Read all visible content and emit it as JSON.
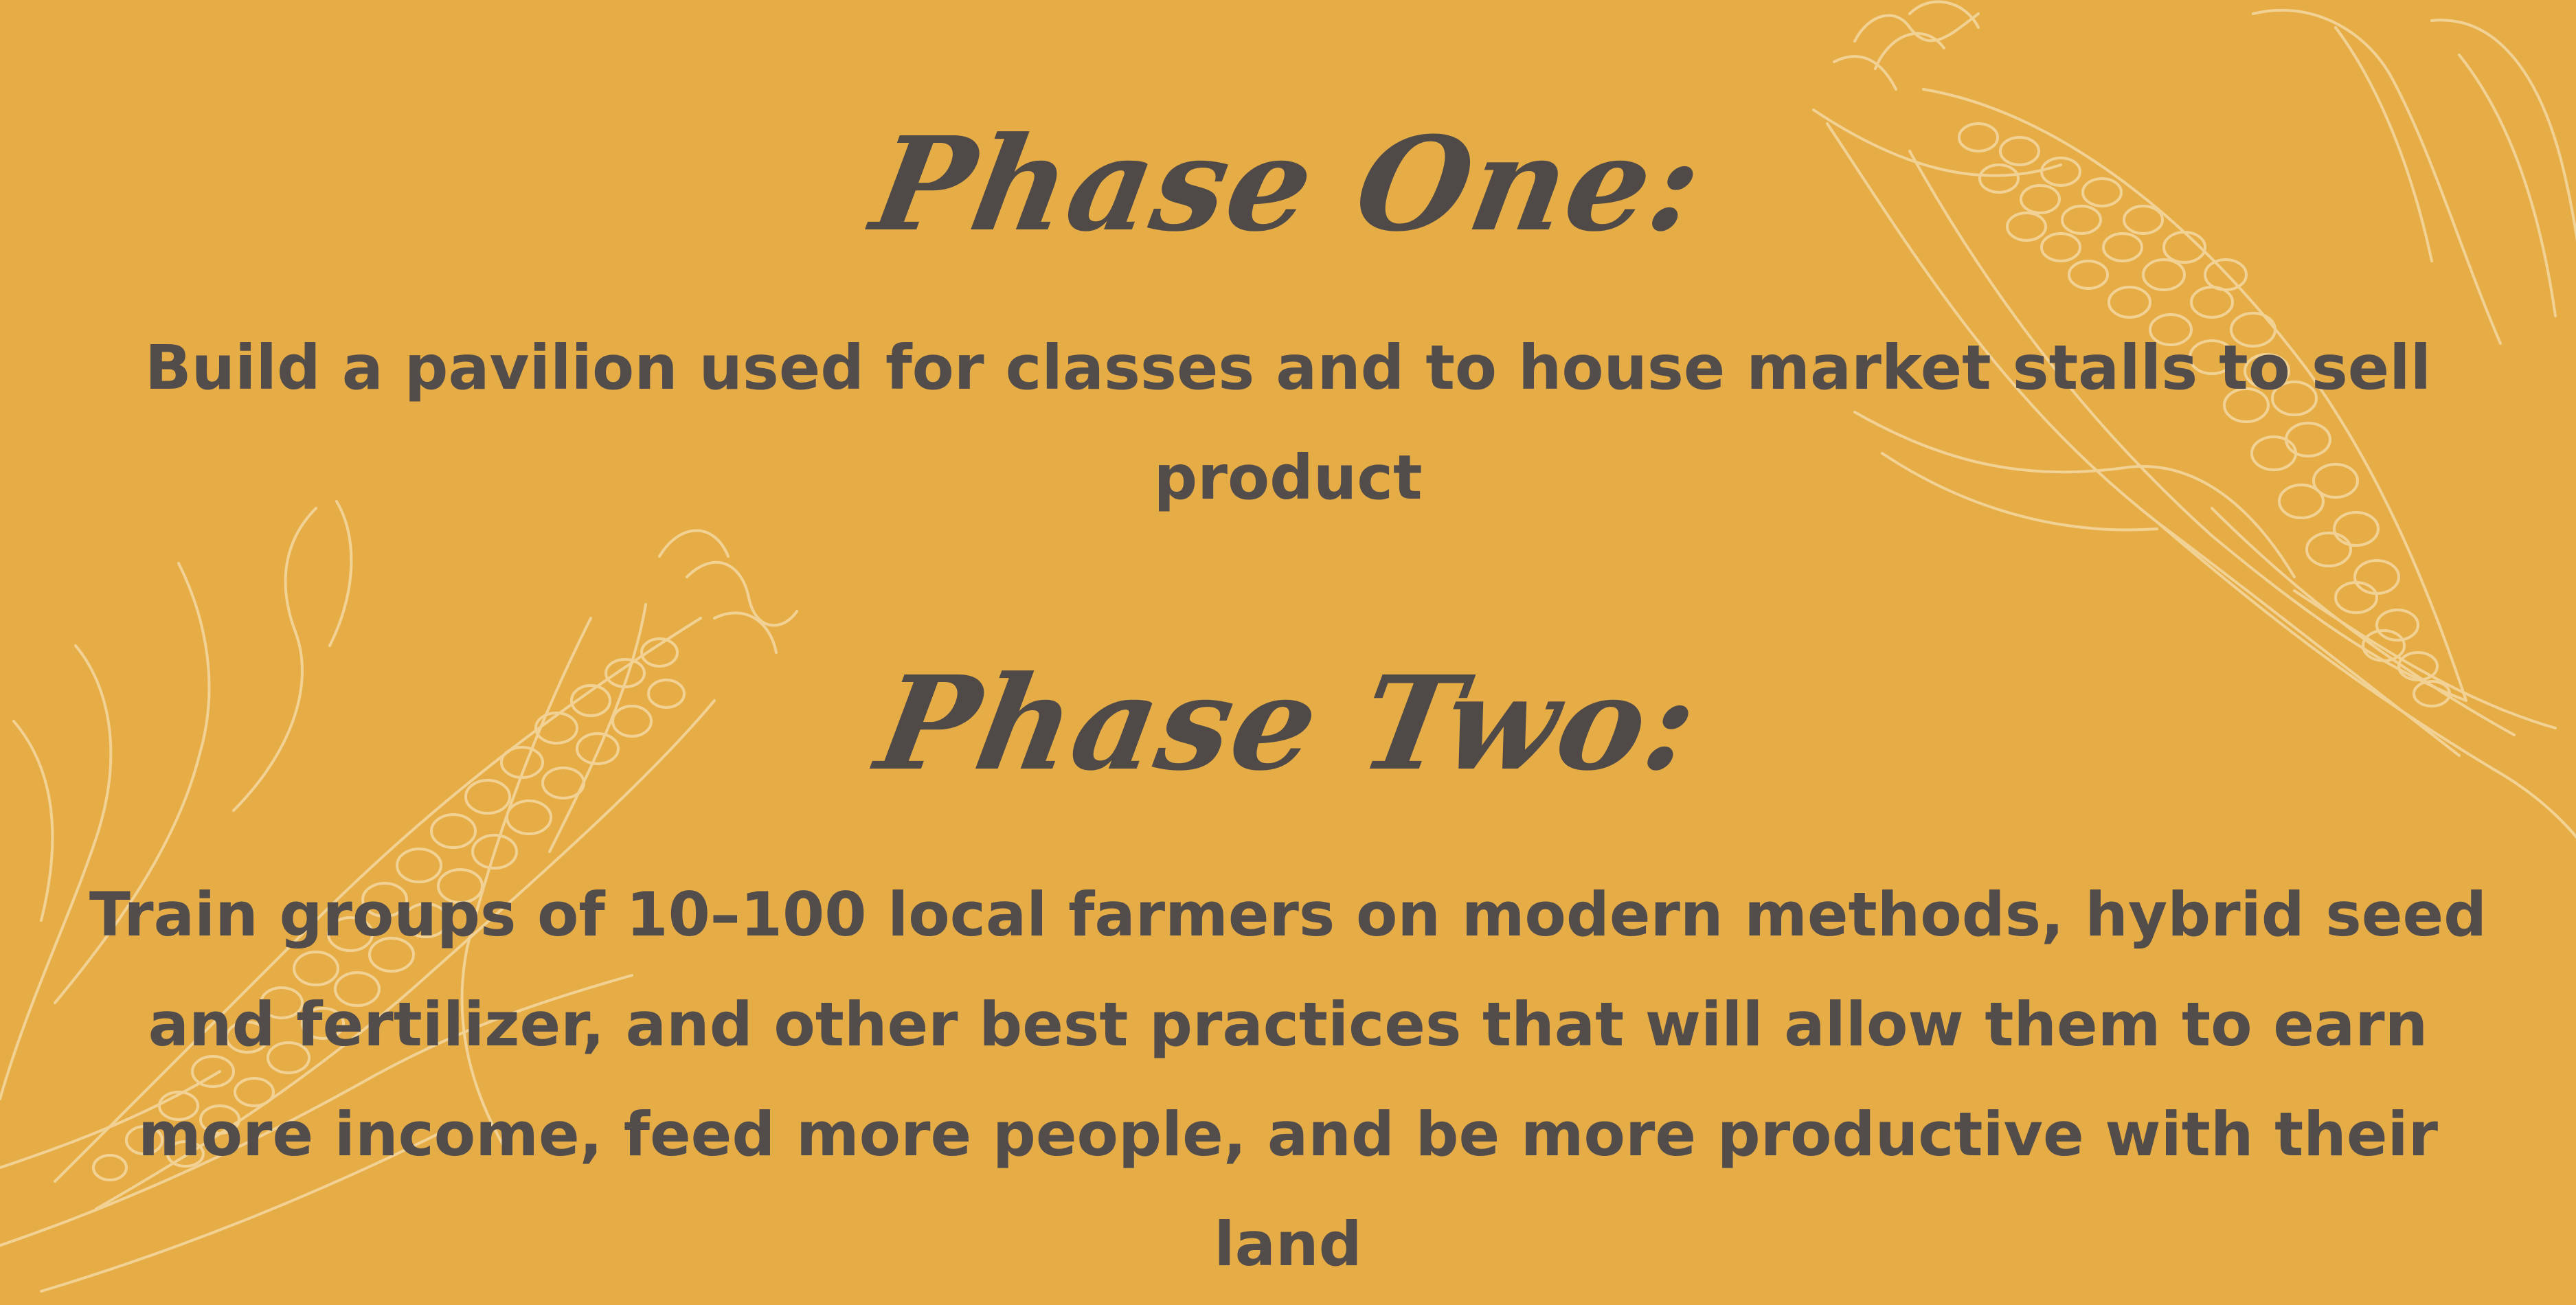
{
  "colors": {
    "background": "#e6ad47",
    "text": "#524d4b",
    "illustration": "#f4d9a2"
  },
  "illustrations": [
    "corn-cob-icon",
    "corn-cob-icon"
  ],
  "phase_one": {
    "heading": "Phase One:",
    "body": "Build a pavilion used for classes and to house market stalls to sell product"
  },
  "phase_two": {
    "heading": "Phase Two:",
    "body": "Train groups of 10–100 local farmers on modern methods, hybrid seed and fertilizer, and other best practices that will allow them to earn more income, feed more people, and be more productive with their land"
  }
}
